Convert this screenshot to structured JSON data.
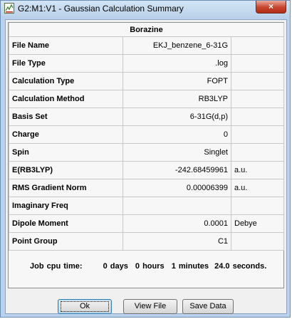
{
  "window": {
    "title": "G2:M1:V1 - Gaussian Calculation Summary",
    "close_glyph": "×"
  },
  "summary": {
    "molecule_name": "Borazine",
    "rows": [
      {
        "label": "File Name",
        "value": "EKJ_benzene_6-31G",
        "unit": ""
      },
      {
        "label": "File Type",
        "value": ".log",
        "unit": ""
      },
      {
        "label": "Calculation Type",
        "value": "FOPT",
        "unit": ""
      },
      {
        "label": "Calculation Method",
        "value": "RB3LYP",
        "unit": ""
      },
      {
        "label": "Basis Set",
        "value": "6-31G(d,p)",
        "unit": ""
      },
      {
        "label": "Charge",
        "value": "0",
        "unit": ""
      },
      {
        "label": "Spin",
        "value": "Singlet",
        "unit": ""
      },
      {
        "label": "E(RB3LYP)",
        "value": "-242.68459961",
        "unit": "a.u."
      },
      {
        "label": "RMS Gradient Norm",
        "value": "0.00006399",
        "unit": "a.u."
      },
      {
        "label": "Imaginary Freq",
        "value": "",
        "unit": ""
      },
      {
        "label": "Dipole Moment",
        "value": "0.0001",
        "unit": "Debye"
      },
      {
        "label": "Point Group",
        "value": "C1",
        "unit": ""
      }
    ],
    "cpu_time": {
      "label": "Job cpu time:",
      "days": "0 days",
      "hours": "0 hours",
      "minutes": "1 minutes",
      "seconds": "24.0 seconds."
    }
  },
  "buttons": {
    "ok": "Ok",
    "view_file": "View File",
    "save_data": "Save Data"
  },
  "icons": {
    "app": "gaussview-app-icon",
    "close": "close-icon"
  }
}
